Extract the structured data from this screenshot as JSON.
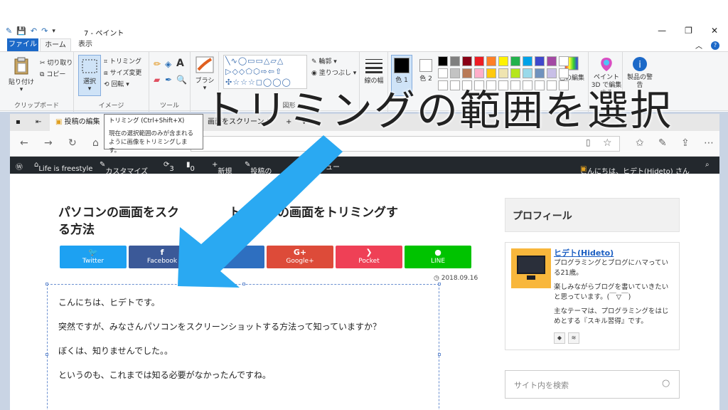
{
  "titlebar": {
    "title": "7 - ペイント",
    "qa_down": "▾",
    "minimize": "—",
    "maximize": "❐",
    "close": "✕"
  },
  "ribbon_tabs": {
    "file": "ファイル",
    "home": "ホーム",
    "view": "表示",
    "collapse": "︿",
    "help": "?"
  },
  "ribbon": {
    "clipboard": {
      "paste": "貼り付け",
      "cut": "切り取り",
      "copy": "コピー",
      "label": "クリップボード"
    },
    "image": {
      "select": "選択",
      "crop": "トリミング",
      "resize": "サイズ変更",
      "rotate": "回転",
      "label": "イメージ"
    },
    "tools": {
      "label": "ツール"
    },
    "brush": {
      "label": "ブラシ"
    },
    "shapes": {
      "outline": "輪郭",
      "fill": "塗りつぶし",
      "label": "図形"
    },
    "size": {
      "label": "線の幅"
    },
    "colors": {
      "color1": "色 1",
      "color2": "色 2",
      "edit": "色の編集",
      "label": "色"
    },
    "paint3d": {
      "label": "ペイント 3D で編集する"
    },
    "product": {
      "label": "製品の警告"
    }
  },
  "palette": [
    "#000000",
    "#7f7f7f",
    "#880015",
    "#ed1c24",
    "#ff7f27",
    "#fff200",
    "#22b14c",
    "#00a2e8",
    "#3f48cc",
    "#a349a4",
    "#ffffff",
    "#ffffff",
    "#c3c3c3",
    "#b97a57",
    "#ffaec9",
    "#ffc90e",
    "#efe4b0",
    "#b5e61d",
    "#99d9ea",
    "#7092be",
    "#c8bfe7",
    "#ffffff",
    "#ffffff",
    "#ffffff",
    "#ffffff",
    "#ffffff",
    "#ffffff",
    "#ffffff",
    "#ffffff",
    "#ffffff",
    "#ffffff",
    "#ffffff",
    "#ffffff"
  ],
  "tooltip": {
    "title": "トリミング (Ctrl+Shift+X)",
    "body1": "現在の選択範囲のみが含まれる",
    "body2": "ように画像をトリミングします。"
  },
  "browser": {
    "tab1": "投稿の編集",
    "tab2": "画面をスクリーン",
    "address": "h",
    "wpbar": {
      "site": "Life is freestyle",
      "customize": "カスタマイズ",
      "updates": "3",
      "comments": "0",
      "new": "新規",
      "edit": "投稿の",
      "menu": "ニュー",
      "greeting": "こんにちは、ヒデト(Hideto) さん"
    }
  },
  "post": {
    "title_line1": "パソコンの画面をスク",
    "title_line1_tail": "トし、その画面をトリミングす",
    "title_line2": "る方法",
    "date": "2018.09.16",
    "paragraphs": [
      "こんにちは、ヒデトです。",
      "突然ですが、みなさんパソコンをスクリーンショットする方法って知っていますか？",
      "ぼくは、知りませんでした。。",
      "というのも、これまでは知る必要がなかったんですね。"
    ]
  },
  "share": [
    {
      "label": "Twitter",
      "icon": "🐦",
      "color": "#1da1f2"
    },
    {
      "label": "Facebook",
      "icon": "f",
      "color": "#3b5998"
    },
    {
      "label": "",
      "icon": "",
      "color": "#2e6fc0"
    },
    {
      "label": "Google+",
      "icon": "G+",
      "color": "#dd4b39"
    },
    {
      "label": "Pocket",
      "icon": "❯",
      "color": "#ef4056"
    },
    {
      "label": "LINE",
      "icon": "●",
      "color": "#00c300"
    }
  ],
  "sidebar": {
    "profile_heading": "プロフィール",
    "name": "ヒデト(Hideto)",
    "desc1": "プログラミングとブログにハマっている21歳。",
    "desc2": "楽しみながらブログを書いていきたいと思っています。(￣▽￣)",
    "desc3": "主なテーマは、プログラミングをはじめとする『スキル習得』です。",
    "search_placeholder": "サイト内を検索"
  },
  "caption": "トリミングの範囲を選択",
  "arrow_color": "#2aa9f2"
}
